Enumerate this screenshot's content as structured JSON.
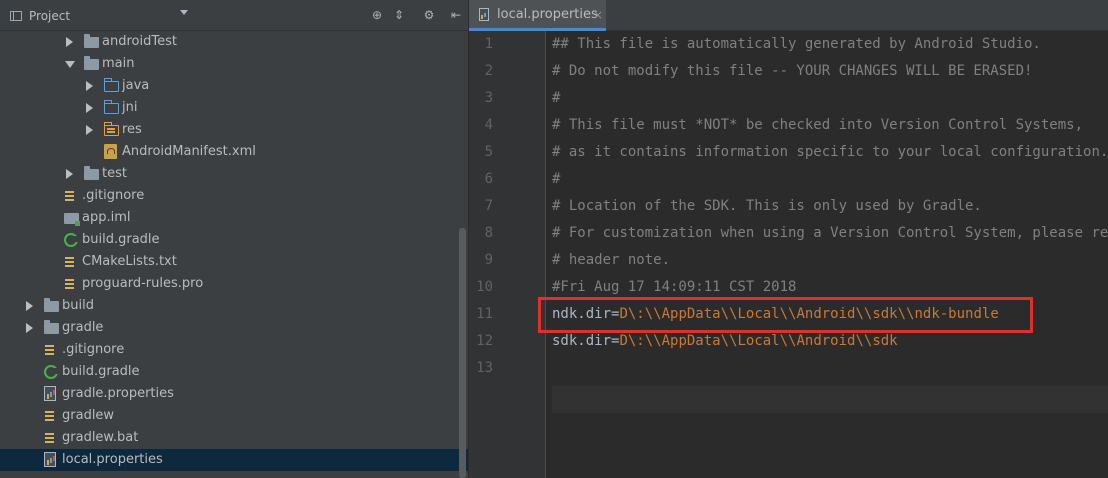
{
  "project_panel": {
    "title": "Project",
    "header_icons": [
      "target-icon",
      "collapse-all-icon",
      "gear-icon",
      "hide-panel-icon"
    ],
    "tree": [
      {
        "label": "androidTest",
        "icon": "folder-icon",
        "expanded": false,
        "has_arrow": true,
        "depth": 3
      },
      {
        "label": "main",
        "icon": "folder-icon",
        "expanded": true,
        "has_arrow": true,
        "depth": 3
      },
      {
        "label": "java",
        "icon": "source-folder-icon",
        "expanded": false,
        "has_arrow": true,
        "depth": 4
      },
      {
        "label": "jni",
        "icon": "source-folder-icon",
        "expanded": false,
        "has_arrow": true,
        "depth": 4
      },
      {
        "label": "res",
        "icon": "resource-folder-icon",
        "expanded": false,
        "has_arrow": true,
        "depth": 4
      },
      {
        "label": "AndroidManifest.xml",
        "icon": "android-manifest-icon",
        "has_arrow": false,
        "depth": 4
      },
      {
        "label": "test",
        "icon": "folder-icon",
        "expanded": false,
        "has_arrow": true,
        "depth": 3
      },
      {
        "label": ".gitignore",
        "icon": "text-file-icon",
        "has_arrow": false,
        "depth": 2
      },
      {
        "label": "app.iml",
        "icon": "module-file-icon",
        "has_arrow": false,
        "depth": 2
      },
      {
        "label": "build.gradle",
        "icon": "gradle-icon",
        "has_arrow": false,
        "depth": 2
      },
      {
        "label": "CMakeLists.txt",
        "icon": "text-file-icon",
        "has_arrow": false,
        "depth": 2
      },
      {
        "label": "proguard-rules.pro",
        "icon": "text-file-icon",
        "has_arrow": false,
        "depth": 2
      },
      {
        "label": "build",
        "icon": "folder-icon",
        "expanded": false,
        "has_arrow": true,
        "depth": 1
      },
      {
        "label": "gradle",
        "icon": "folder-icon",
        "expanded": false,
        "has_arrow": true,
        "depth": 1
      },
      {
        "label": ".gitignore",
        "icon": "text-file-icon",
        "has_arrow": false,
        "depth": 1
      },
      {
        "label": "build.gradle",
        "icon": "gradle-icon",
        "has_arrow": false,
        "depth": 1
      },
      {
        "label": "gradle.properties",
        "icon": "properties-file-icon",
        "has_arrow": false,
        "depth": 1
      },
      {
        "label": "gradlew",
        "icon": "text-file-icon",
        "has_arrow": false,
        "depth": 1
      },
      {
        "label": "gradlew.bat",
        "icon": "text-file-icon",
        "has_arrow": false,
        "depth": 1
      },
      {
        "label": "local.properties",
        "icon": "properties-file-icon",
        "has_arrow": false,
        "depth": 1,
        "selected": true
      }
    ]
  },
  "editor": {
    "tab": {
      "label": "local.properties",
      "close": "×"
    },
    "line_numbers": [
      "1",
      "2",
      "3",
      "4",
      "5",
      "6",
      "7",
      "8",
      "9",
      "10",
      "11",
      "12",
      "13"
    ],
    "lines": [
      {
        "type": "comment",
        "text": "## This file is automatically generated by Android Studio."
      },
      {
        "type": "comment",
        "text": "# Do not modify this file -- YOUR CHANGES WILL BE ERASED!"
      },
      {
        "type": "comment",
        "text": "#"
      },
      {
        "type": "comment",
        "text": "# This file must *NOT* be checked into Version Control Systems,"
      },
      {
        "type": "comment",
        "text": "# as it contains information specific to your local configuration."
      },
      {
        "type": "comment",
        "text": "#"
      },
      {
        "type": "comment",
        "text": "# Location of the SDK. This is only used by Gradle."
      },
      {
        "type": "comment",
        "text": "# For customization when using a Version Control System, please read the"
      },
      {
        "type": "comment",
        "text": "# header note."
      },
      {
        "type": "comment",
        "text": "#Fri Aug 17 14:09:11 CST 2018"
      },
      {
        "type": "property",
        "key": "ndk.dir",
        "eq": "=",
        "value": "D\\:\\\\AppData\\\\Local\\\\Android\\\\sdk\\\\ndk-bundle"
      },
      {
        "type": "property",
        "key": "sdk.dir",
        "eq": "=",
        "value": "D\\:\\\\AppData\\\\Local\\\\Android\\\\sdk"
      },
      {
        "type": "empty",
        "text": ""
      }
    ],
    "colors": {
      "comment": "#808080",
      "key": "#a9b7c6",
      "value": "#cc7832",
      "highlight_box": "#e0302e"
    }
  }
}
